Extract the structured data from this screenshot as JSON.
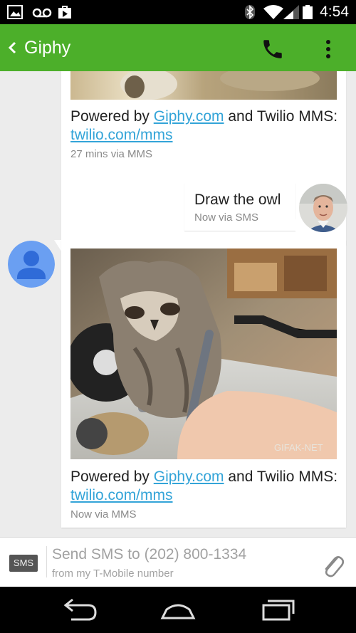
{
  "status_bar": {
    "time": "4:54",
    "left_icons": [
      "image-notification-icon",
      "voicemail-icon",
      "play-store-icon"
    ],
    "right_icons": [
      "bluetooth-icon",
      "wifi-icon",
      "signal-icon",
      "battery-icon"
    ]
  },
  "action_bar": {
    "back_icon": "chevron-left-icon",
    "title": "Giphy",
    "call_icon": "phone-icon",
    "menu_icon": "more-vert-icon",
    "color": "#4caf2a"
  },
  "messages": [
    {
      "direction": "incoming",
      "has_image": true,
      "text_before_link1": "Powered by ",
      "link1": "Giphy.com",
      "text_between": " and Twilio MMS: ",
      "link2": "twilio.com/mms",
      "meta": "27 mins via MMS"
    },
    {
      "direction": "outgoing",
      "text": "Draw the owl",
      "meta": "Now via SMS"
    },
    {
      "direction": "incoming",
      "has_image": true,
      "image_watermark": "GIFAK-NET",
      "text_before_link1": "Powered by ",
      "link1": "Giphy.com",
      "text_between": " and Twilio MMS: ",
      "link2": "twilio.com/mms",
      "meta": "Now via MMS"
    }
  ],
  "compose": {
    "badge": "SMS",
    "placeholder": "Send SMS to (202) 800-1334",
    "subtext": "from my T-Mobile number",
    "attach_icon": "paperclip-icon"
  },
  "nav_bar": {
    "icons": [
      "back-icon",
      "home-icon",
      "recents-icon"
    ]
  },
  "colors": {
    "link": "#33a4d8",
    "background": "#ececec",
    "contact_avatar": "#6a9ff2"
  }
}
